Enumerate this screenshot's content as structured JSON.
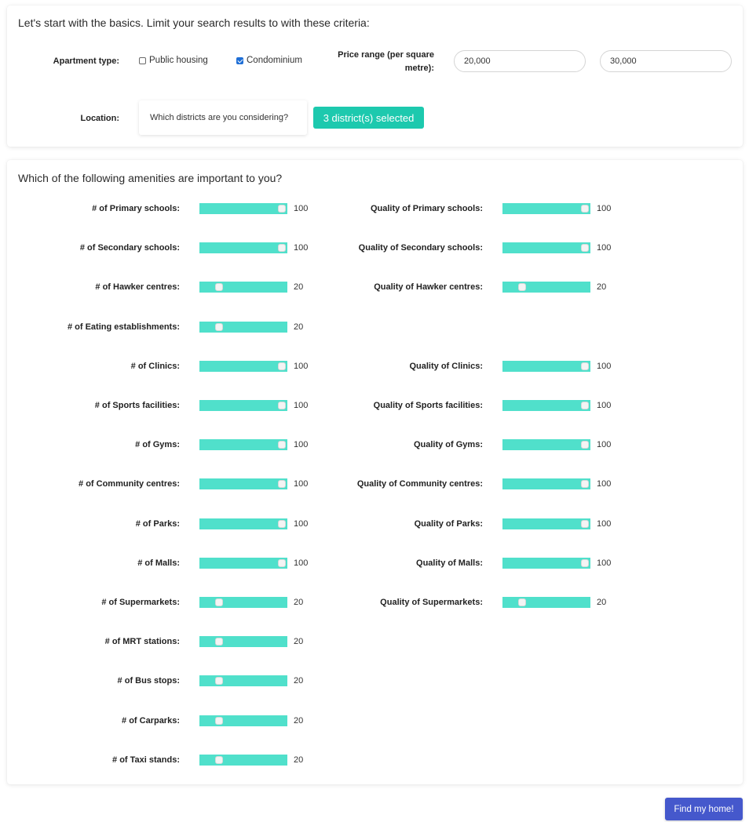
{
  "basics": {
    "heading": "Let's start with the basics. Limit your search results to with these criteria:",
    "apartment_type_label": "Apartment type:",
    "options": [
      {
        "label": "Public housing",
        "checked": false
      },
      {
        "label": "Condominium",
        "checked": true
      }
    ],
    "price_label": "Price range (per square metre):",
    "price_min": "20,000",
    "price_max": "30,000",
    "location_label": "Location:",
    "district_placeholder": "Which districts are you considering?",
    "district_button": "3 district(s) selected"
  },
  "amenities": {
    "heading": "Which of the following amenities are important to you?",
    "left": [
      {
        "label": "# of Primary schools:",
        "value": "100",
        "level": 1.0
      },
      {
        "label": "# of Secondary schools:",
        "value": "100",
        "level": 1.0
      },
      {
        "label": "# of Hawker centres:",
        "value": "20",
        "level": 0.2
      },
      {
        "label": "# of Eating establishments:",
        "value": "20",
        "level": 0.2
      },
      {
        "label": "# of Clinics:",
        "value": "100",
        "level": 1.0
      },
      {
        "label": "# of Sports facilities:",
        "value": "100",
        "level": 1.0
      },
      {
        "label": "# of Gyms:",
        "value": "100",
        "level": 1.0
      },
      {
        "label": "# of Community centres:",
        "value": "100",
        "level": 1.0
      },
      {
        "label": "# of Parks:",
        "value": "100",
        "level": 1.0
      },
      {
        "label": "# of Malls:",
        "value": "100",
        "level": 1.0
      },
      {
        "label": "# of Supermarkets:",
        "value": "20",
        "level": 0.2
      },
      {
        "label": "# of MRT stations:",
        "value": "20",
        "level": 0.2
      },
      {
        "label": "# of Bus stops:",
        "value": "20",
        "level": 0.2
      },
      {
        "label": "# of Carparks:",
        "value": "20",
        "level": 0.2
      },
      {
        "label": "# of Taxi stands:",
        "value": "20",
        "level": 0.2
      }
    ],
    "right": [
      {
        "label": "Quality of Primary schools:",
        "value": "100",
        "level": 1.0
      },
      {
        "label": "Quality of Secondary schools:",
        "value": "100",
        "level": 1.0
      },
      {
        "label": "Quality of Hawker centres:",
        "value": "20",
        "level": 0.2
      },
      null,
      {
        "label": "Quality of Clinics:",
        "value": "100",
        "level": 1.0
      },
      {
        "label": "Quality of Sports facilities:",
        "value": "100",
        "level": 1.0
      },
      {
        "label": "Quality of Gyms:",
        "value": "100",
        "level": 1.0
      },
      {
        "label": "Quality of Community centres:",
        "value": "100",
        "level": 1.0
      },
      {
        "label": "Quality of Parks:",
        "value": "100",
        "level": 1.0
      },
      {
        "label": "Quality of Malls:",
        "value": "100",
        "level": 1.0
      },
      {
        "label": "Quality of Supermarkets:",
        "value": "20",
        "level": 0.2
      }
    ]
  },
  "submit_label": "Find my home!",
  "colors": {
    "slider": "#50e0cb",
    "accent": "#1dc9ae",
    "primary_button": "#4558cc"
  }
}
